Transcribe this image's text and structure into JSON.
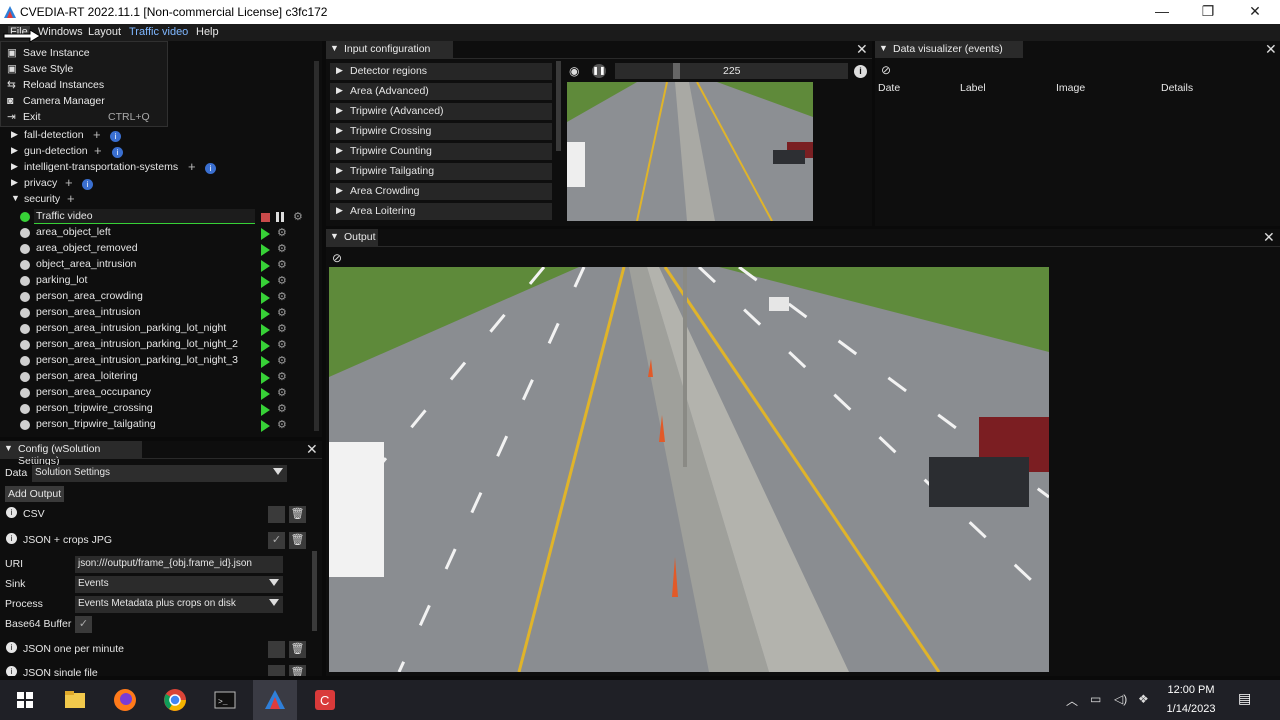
{
  "window": {
    "title": "CVEDIA-RT 2022.11.1    [Non-commercial License] c3fc172",
    "minimize": "—",
    "maximize": "❐",
    "close": "✕"
  },
  "menubar": {
    "items": [
      {
        "label": "File"
      },
      {
        "label": "Windows"
      },
      {
        "label": "Layout"
      },
      {
        "label": "Traffic video"
      },
      {
        "label": "Help"
      }
    ]
  },
  "file_menu": {
    "items": [
      {
        "label": "Save Instance",
        "icon": "save-icon"
      },
      {
        "label": "Save Style",
        "icon": "save-icon"
      },
      {
        "label": "Reload Instances",
        "icon": "reload-icon"
      },
      {
        "label": "Camera Manager",
        "icon": "camera-icon"
      },
      {
        "label": "Exit",
        "shortcut": "CTRL+Q",
        "icon": "exit-icon"
      }
    ]
  },
  "tree": {
    "groups": [
      {
        "label": "fall-detection"
      },
      {
        "label": "gun-detection"
      },
      {
        "label": "intelligent-transportation-systems"
      },
      {
        "label": "privacy"
      },
      {
        "label": "security"
      }
    ],
    "instances": [
      {
        "label": "Traffic video",
        "active": true
      },
      {
        "label": "area_object_left"
      },
      {
        "label": "area_object_removed"
      },
      {
        "label": "object_area_intrusion"
      },
      {
        "label": "parking_lot"
      },
      {
        "label": "person_area_crowding"
      },
      {
        "label": "person_area_intrusion"
      },
      {
        "label": "person_area_intrusion_parking_lot_night"
      },
      {
        "label": "person_area_intrusion_parking_lot_night_2"
      },
      {
        "label": "person_area_intrusion_parking_lot_night_3"
      },
      {
        "label": "person_area_loitering"
      },
      {
        "label": "person_area_occupancy"
      },
      {
        "label": "person_tripwire_crossing"
      },
      {
        "label": "person_tripwire_tailgating"
      }
    ]
  },
  "input_config": {
    "title": "Input configuration",
    "items": [
      "Detector regions",
      "Area (Advanced)",
      "Tripwire (Advanced)",
      "Tripwire Crossing",
      "Tripwire Counting",
      "Tripwire Tailgating",
      "Area Crowding",
      "Area Loitering"
    ],
    "frame_value": "225"
  },
  "data_visualizer": {
    "title": "Data visualizer (events)",
    "columns": [
      "Date",
      "Label",
      "Image",
      "Details"
    ]
  },
  "output": {
    "title": "Output"
  },
  "config": {
    "title": "Config (wSolution Settings)",
    "data_label": "Data",
    "data_value": "Solution Settings",
    "add_output": "Add Output",
    "outputs": [
      "CSV",
      "JSON + crops JPG",
      "JSON one per minute",
      "JSON single file"
    ],
    "uri_label": "URI",
    "uri_value": "json:///output/frame_{obj.frame_id}.json",
    "sink_label": "Sink",
    "sink_value": "Events",
    "process_label": "Process",
    "process_value": "Events Metadata plus crops on disk",
    "base64_label": "Base64 Buffer"
  },
  "taskbar": {
    "time": "12:00 PM",
    "date": "1/14/2023"
  },
  "colors": {
    "accent_green": "#37d137",
    "info_blue": "#3a6fd0",
    "stop_red": "#c94a4a",
    "road_yellow": "#e0b42a"
  }
}
